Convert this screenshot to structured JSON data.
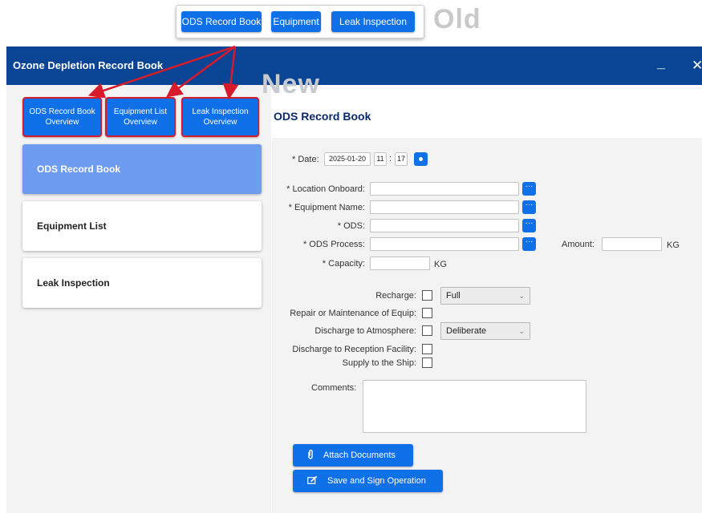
{
  "old_toolbar": {
    "label": "Old",
    "buttons": [
      "ODS Record Book",
      "Equipment",
      "Leak Inspection"
    ]
  },
  "new_label": "New",
  "window": {
    "title": "Ozone Depletion Record Book",
    "minimize": "_",
    "close": "✕"
  },
  "overview_buttons": [
    {
      "line1": "ODS Record Book",
      "line2": "Overview"
    },
    {
      "line1": "Equipment List",
      "line2": "Overview"
    },
    {
      "line1": "Leak Inspection",
      "line2": "Overview"
    }
  ],
  "nav": [
    "ODS Record Book",
    "Equipment List",
    "Leak Inspection"
  ],
  "form": {
    "title": "ODS Record Book",
    "date_label": "* Date:",
    "date_value": "2025-01-20",
    "hour": "11",
    "time_sep": ":",
    "minute": "17",
    "location_label": "* Location Onboard:",
    "equipment_label": "* Equipment Name:",
    "ods_label": "* ODS:",
    "process_label": "* ODS Process:",
    "amount_label": "Amount:",
    "amount_unit": "KG",
    "capacity_label": "* Capacity:",
    "capacity_unit": "KG",
    "recharge_label": "Recharge:",
    "recharge_option": "Full",
    "repair_label": "Repair or Maintenance of Equip:",
    "discharge_atm_label": "Discharge to Atmosphere:",
    "discharge_atm_option": "Deliberate",
    "discharge_rec_label": "Discharge to Reception Facility:",
    "supply_label": "Supply to the Ship:",
    "comments_label": "Comments:",
    "attach_button": "Attach Documents",
    "save_button": "Save and Sign Operation"
  },
  "colors": {
    "accent": "#1070e8",
    "titlebar": "#0a4595",
    "nav_active": "#6d9cf0",
    "annotation_red": "#d81b2a"
  }
}
